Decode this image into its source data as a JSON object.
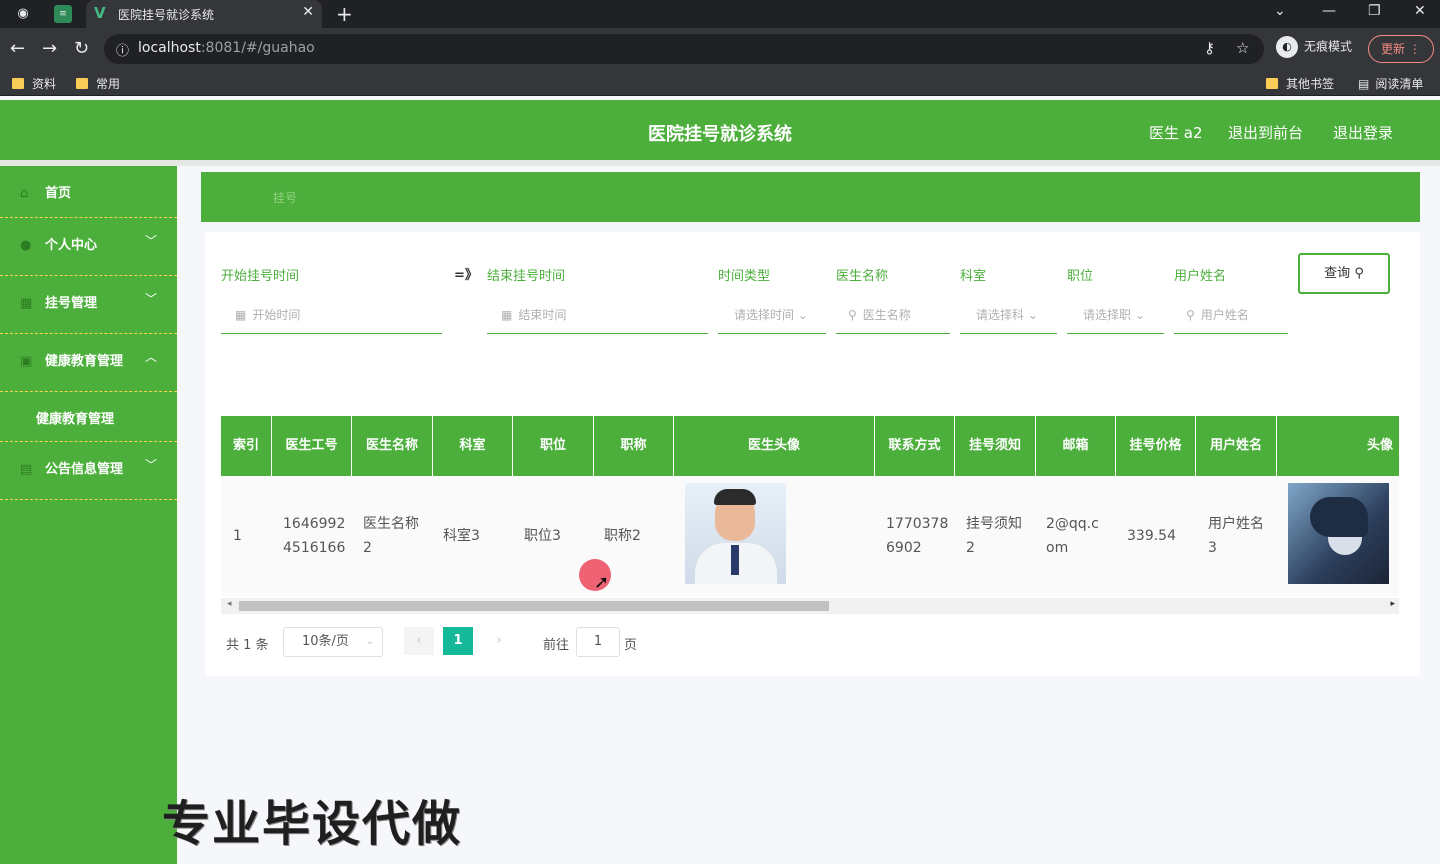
{
  "browser": {
    "tab_title": "医院挂号就诊系统",
    "url_host": "localhost",
    "url_rest": ":8081/#/guahao",
    "incognito_label": "无痕模式",
    "update_label": "更新",
    "bookmarks": [
      "资料",
      "常用"
    ],
    "bookmarks_right": [
      "其他书签",
      "阅读清单"
    ]
  },
  "header": {
    "title": "医院挂号就诊系统",
    "user": "医生 a2",
    "to_front": "退出到前台",
    "logout": "退出登录"
  },
  "sidebar": {
    "items": [
      {
        "label": "首页",
        "icon": "home-icon"
      },
      {
        "label": "个人中心",
        "icon": "user-icon",
        "chev": "﹀"
      },
      {
        "label": "挂号管理",
        "icon": "register-icon",
        "chev": "﹀"
      },
      {
        "label": "健康教育管理",
        "icon": "education-icon",
        "chev": "︿"
      },
      {
        "label": "公告信息管理",
        "icon": "notice-icon",
        "chev": "﹀"
      }
    ],
    "sub_item": "健康教育管理"
  },
  "breadcrumb": "挂号",
  "filters": {
    "start_label": "开始挂号时间",
    "start_placeholder": "开始时间",
    "end_label": "结束挂号时间",
    "end_placeholder": "结束时间",
    "type_label": "时间类型",
    "type_placeholder": "请选择时间",
    "doctor_label": "医生名称",
    "doctor_placeholder": "医生名称",
    "dept_label": "科室",
    "dept_placeholder": "请选择科",
    "pos_label": "职位",
    "pos_placeholder": "请选择职",
    "user_label": "用户姓名",
    "user_placeholder": "用户姓名",
    "query_button": "查询"
  },
  "table": {
    "headers": [
      "索引",
      "医生工号",
      "医生名称",
      "科室",
      "职位",
      "职称",
      "医生头像",
      "联系方式",
      "挂号须知",
      "邮箱",
      "挂号价格",
      "用户姓名",
      "头像"
    ],
    "row": {
      "index": "1",
      "doc_id_1": "1646992",
      "doc_id_2": "4516166",
      "doc_name_1": "医生名称",
      "doc_name_2": "2",
      "dept": "科室3",
      "position": "职位3",
      "title": "职称2",
      "phone_1": "1770378",
      "phone_2": "6902",
      "notice_1": "挂号须知",
      "notice_2": "2",
      "email_1": "2@qq.c",
      "email_2": "om",
      "price": "339.54",
      "user_name_1": "用户姓名",
      "user_name_2": "3"
    }
  },
  "pagination": {
    "total": "共 1 条",
    "page_size": "10条/页",
    "prev": "‹",
    "current": "1",
    "next": "›",
    "goto_label": "前往",
    "goto_value": "1",
    "goto_suffix": "页"
  },
  "watermark": "专业毕设代做"
}
